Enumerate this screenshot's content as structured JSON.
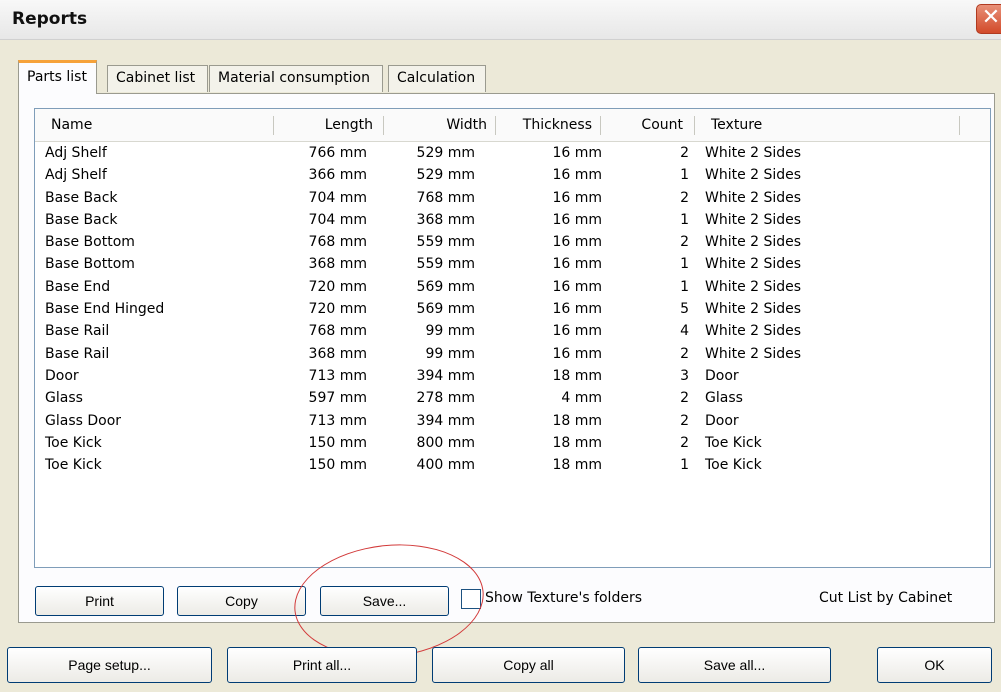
{
  "window": {
    "title": "Reports",
    "close_label": "✕"
  },
  "tabs": [
    {
      "label": "Parts list",
      "active": true
    },
    {
      "label": "Cabinet list",
      "active": false
    },
    {
      "label": "Material consumption",
      "active": false
    },
    {
      "label": "Calculation",
      "active": false
    }
  ],
  "table": {
    "columns": [
      "Name",
      "Length",
      "Width",
      "Thickness",
      "Count",
      "Texture"
    ],
    "rows": [
      [
        "Adj Shelf",
        "766 mm",
        "529 mm",
        "16 mm",
        "2",
        "White 2 Sides"
      ],
      [
        "Adj Shelf",
        "366 mm",
        "529 mm",
        "16 mm",
        "1",
        "White 2 Sides"
      ],
      [
        "Base Back",
        "704 mm",
        "768 mm",
        "16 mm",
        "2",
        "White 2 Sides"
      ],
      [
        "Base Back",
        "704 mm",
        "368 mm",
        "16 mm",
        "1",
        "White 2 Sides"
      ],
      [
        "Base Bottom",
        "768 mm",
        "559 mm",
        "16 mm",
        "2",
        "White 2 Sides"
      ],
      [
        "Base Bottom",
        "368 mm",
        "559 mm",
        "16 mm",
        "1",
        "White 2 Sides"
      ],
      [
        "Base End",
        "720 mm",
        "569 mm",
        "16 mm",
        "1",
        "White 2 Sides"
      ],
      [
        "Base End Hinged",
        "720 mm",
        "569 mm",
        "16 mm",
        "5",
        "White 2 Sides"
      ],
      [
        "Base Rail",
        "768 mm",
        "99 mm",
        "16 mm",
        "4",
        "White 2 Sides"
      ],
      [
        "Base Rail",
        "368 mm",
        "99 mm",
        "16 mm",
        "2",
        "White 2 Sides"
      ],
      [
        "Door",
        "713 mm",
        "394 mm",
        "18 mm",
        "3",
        "Door"
      ],
      [
        "Glass",
        "597 mm",
        "278 mm",
        "4 mm",
        "2",
        "Glass"
      ],
      [
        "Glass Door",
        "713 mm",
        "394 mm",
        "18 mm",
        "2",
        "Door"
      ],
      [
        "Toe Kick",
        "150 mm",
        "800 mm",
        "18 mm",
        "2",
        "Toe Kick"
      ],
      [
        "Toe Kick",
        "150 mm",
        "400 mm",
        "18 mm",
        "1",
        "Toe Kick"
      ]
    ]
  },
  "panel_buttons": {
    "print": "Print",
    "copy": "Copy",
    "save": "Save..."
  },
  "show_texture_folders": {
    "label": "Show Texture's folders",
    "checked": false
  },
  "cut_list_label": "Cut List by Cabinet",
  "footer_buttons": {
    "page_setup": "Page setup...",
    "print_all": "Print all...",
    "copy_all": "Copy all",
    "save_all": "Save all...",
    "ok": "OK"
  }
}
